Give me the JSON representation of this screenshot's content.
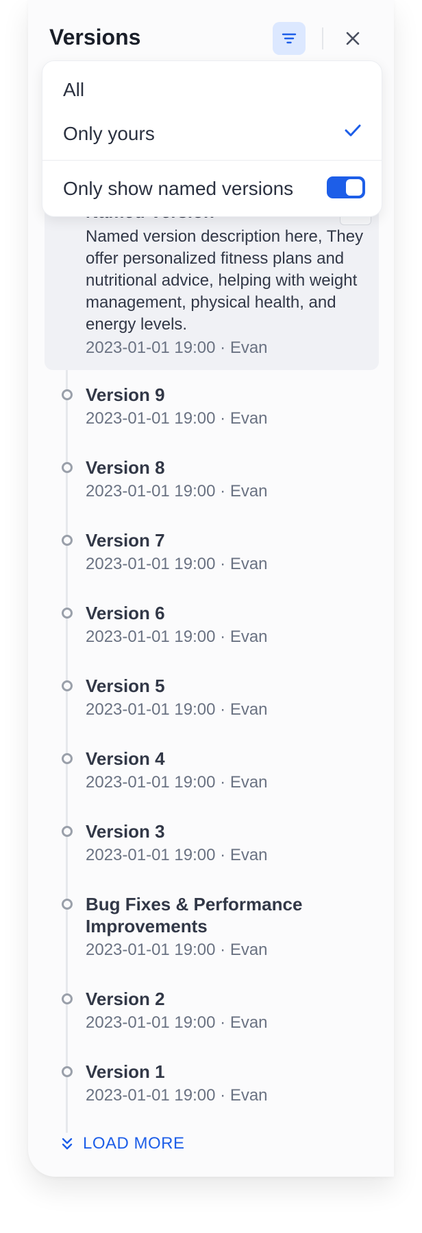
{
  "panel": {
    "title": "Versions",
    "filter_icon": "filter-icon",
    "close_icon": "close-icon"
  },
  "filter_menu": {
    "options": [
      {
        "label": "All",
        "selected": false
      },
      {
        "label": "Only yours",
        "selected": true
      }
    ],
    "named_toggle": {
      "label": "Only show named versions",
      "on": true
    }
  },
  "named_version": {
    "title": "Named Version",
    "description": "Named version description here, They offer personalized fitness plans and nutritional advice, helping with weight management, physical health, and energy levels.",
    "meta": "2023-01-01 19:00 · Evan"
  },
  "versions": [
    {
      "title": "Version 9",
      "meta": "2023-01-01 19:00 · Evan"
    },
    {
      "title": "Version 8",
      "meta": "2023-01-01 19:00 · Evan"
    },
    {
      "title": "Version 7",
      "meta": "2023-01-01 19:00 · Evan"
    },
    {
      "title": "Version 6",
      "meta": "2023-01-01 19:00 · Evan"
    },
    {
      "title": "Version 5",
      "meta": "2023-01-01 19:00 · Evan"
    },
    {
      "title": "Version 4",
      "meta": "2023-01-01 19:00 · Evan"
    },
    {
      "title": "Version 3",
      "meta": "2023-01-01 19:00 · Evan"
    },
    {
      "title": "Bug Fixes & Performance Improvements",
      "meta": "2023-01-01 19:00 · Evan"
    },
    {
      "title": "Version 2",
      "meta": "2023-01-01 19:00 · Evan"
    },
    {
      "title": "Version 1",
      "meta": "2023-01-01 19:00 · Evan"
    }
  ],
  "load_more": {
    "label": "LOAD MORE",
    "icon": "chevrons-down-icon"
  },
  "colors": {
    "accent": "#1d5ee8",
    "filter_active_bg": "#dce8ff",
    "text": "#323847",
    "muted": "#6a7282"
  }
}
